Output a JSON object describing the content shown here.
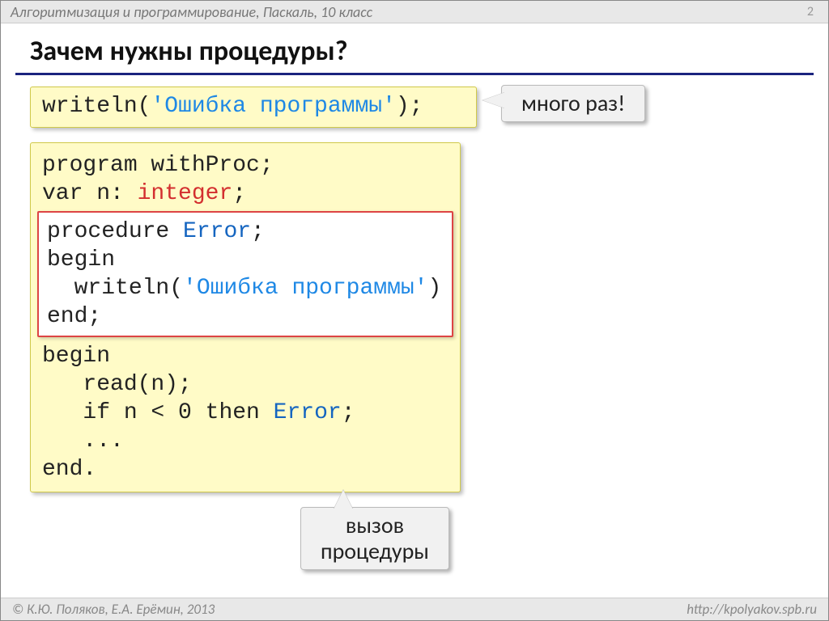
{
  "header": {
    "course": "Алгоритмизация и программирование, Паскаль, 10 класс",
    "page": "2"
  },
  "title": "Зачем нужны процедуры?",
  "code1": {
    "writeln": "writeln(",
    "str": "'Ошибка программы'",
    "end": ");"
  },
  "callout1": "много раз!",
  "code2": {
    "l1a": "program withProc;",
    "l2a": "var n: ",
    "l2b": "integer",
    "l2c": ";",
    "p1a": "procedure ",
    "p1b": "Error",
    "p1c": ";",
    "p2": "begin",
    "p3a": "  writeln(",
    "p3b": "'Ошибка программы'",
    "p3c": ")",
    "p4": "end;",
    "b1": "begin",
    "b2": "   read(n);",
    "b3a": "   if n < ",
    "b3b": "0",
    "b3c": " then ",
    "b3d": "Error",
    "b3e": ";",
    "b4": "   ...",
    "b5": "end."
  },
  "callout2_l1": "вызов",
  "callout2_l2": "процедуры",
  "footer": {
    "left": "© К.Ю. Поляков, Е.А. Ерёмин, 2013",
    "right": "http://kpolyakov.spb.ru"
  }
}
